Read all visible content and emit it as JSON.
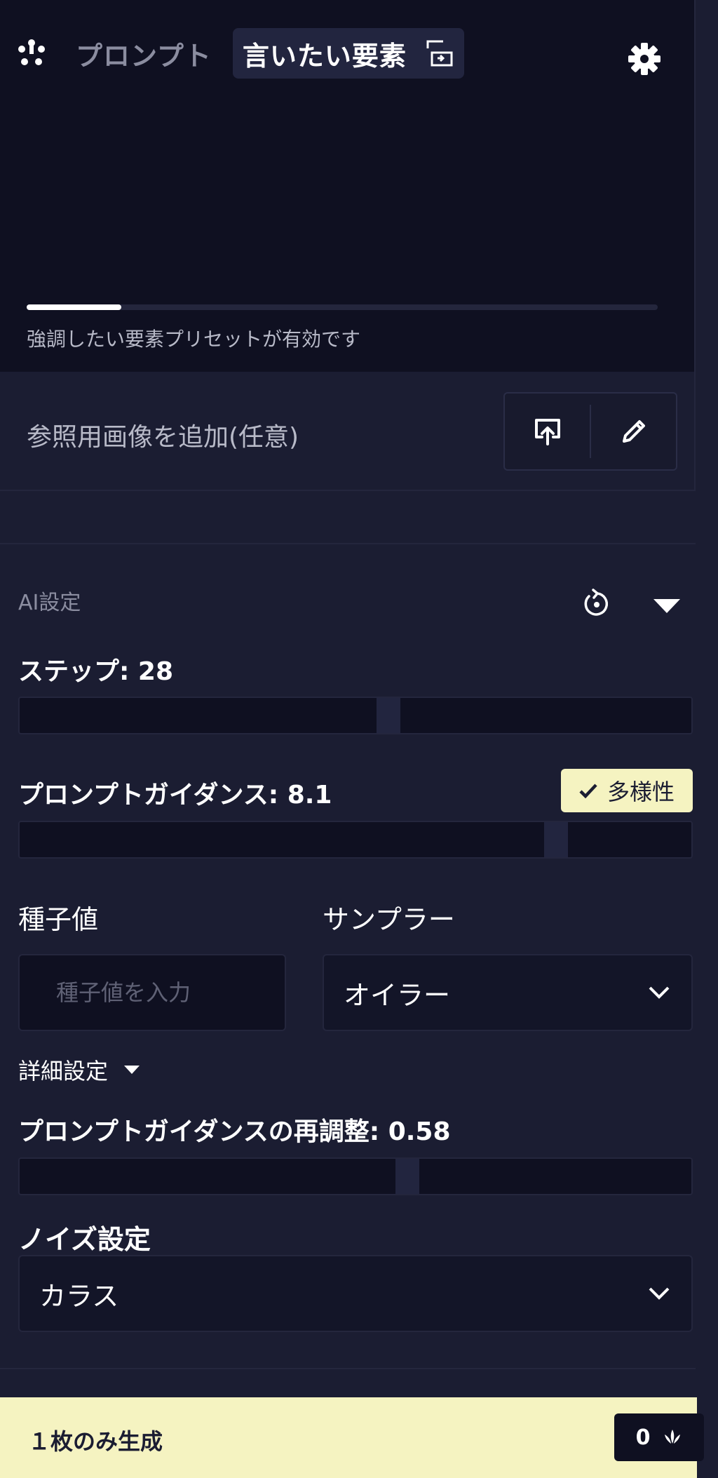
{
  "prompt": {
    "tab_prompt": "プロンプト",
    "tab_elements": "言いたい要素",
    "progress_fraction": 0.15,
    "preset_status": "強調したい要素プリセットが有効です"
  },
  "reference": {
    "label": "参照用画像を追加(任意)"
  },
  "ai_settings": {
    "title": "AI設定",
    "steps": {
      "label": "ステップ: 28",
      "value": 28,
      "min": 1,
      "max": 50
    },
    "guidance": {
      "label": "プロンプトガイダンス: 8.1",
      "value": 8.1,
      "min": 0,
      "max": 10
    },
    "variety_badge": "多様性",
    "seed": {
      "label": "種子値",
      "placeholder": "種子値を入力"
    },
    "sampler": {
      "label": "サンプラー",
      "value": "オイラー"
    },
    "advanced": "詳細設定",
    "rescale": {
      "label": "プロンプトガイダンスの再調整: 0.58",
      "value": 0.58,
      "min": 0,
      "max": 1
    },
    "noise": {
      "label": "ノイズ設定",
      "value": "カラス"
    }
  },
  "footer": {
    "label": "１枚のみ生成",
    "cost": "0"
  },
  "colors": {
    "background": "#1b1d32",
    "panel": "#0f1021",
    "accent_cream": "#f5f3c1"
  }
}
